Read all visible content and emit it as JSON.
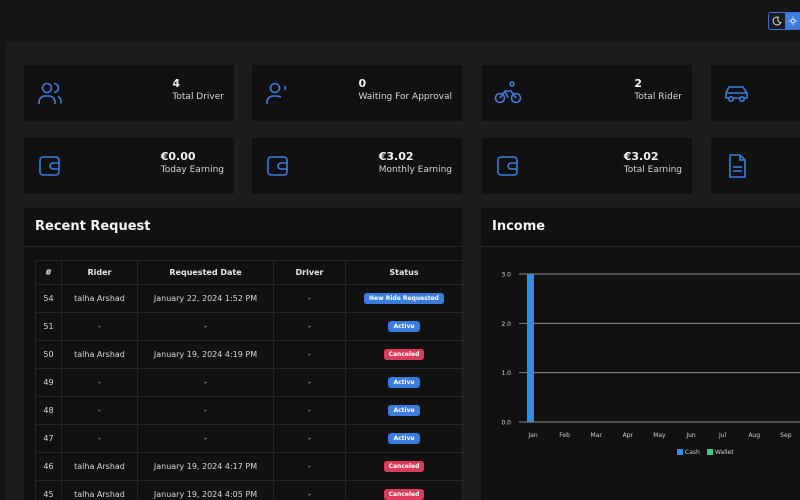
{
  "theme": {
    "dark_icon": "moon-icon",
    "light_icon": "sun-icon"
  },
  "stats": [
    {
      "icon": "users-icon",
      "value": "4",
      "label": "Total Driver"
    },
    {
      "icon": "user-clock-icon",
      "value": "0",
      "label": "Waiting For Approval"
    },
    {
      "icon": "bike-icon",
      "value": "2",
      "label": "Total Rider"
    },
    {
      "icon": "car-icon",
      "value": "",
      "label": ""
    },
    {
      "icon": "wallet-icon",
      "value": "€0.00",
      "label": "Today Earning"
    },
    {
      "icon": "wallet-icon",
      "value": "€3.02",
      "label": "Monthly Earning"
    },
    {
      "icon": "wallet-icon",
      "value": "€3.02",
      "label": "Total Earning"
    },
    {
      "icon": "document-icon",
      "value": "",
      "label": ""
    }
  ],
  "recent": {
    "title": "Recent Request",
    "columns": [
      "#",
      "Rider",
      "Requested Date",
      "Driver",
      "Status"
    ],
    "rows": [
      {
        "id": "54",
        "rider": "talha Arshad",
        "date": "January 22, 2024 1:52 PM",
        "driver": "-",
        "status": "New Ride Requested",
        "color": "#3b7ddd"
      },
      {
        "id": "51",
        "rider": "-",
        "date": "-",
        "driver": "-",
        "status": "Active",
        "color": "#3b7ddd"
      },
      {
        "id": "50",
        "rider": "talha Arshad",
        "date": "January 19, 2024 4:19 PM",
        "driver": "-",
        "status": "Canceled",
        "color": "#dc3b5b"
      },
      {
        "id": "49",
        "rider": "-",
        "date": "-",
        "driver": "-",
        "status": "Active",
        "color": "#3b7ddd"
      },
      {
        "id": "48",
        "rider": "-",
        "date": "-",
        "driver": "-",
        "status": "Active",
        "color": "#3b7ddd"
      },
      {
        "id": "47",
        "rider": "-",
        "date": "-",
        "driver": "-",
        "status": "Active",
        "color": "#3b7ddd"
      },
      {
        "id": "46",
        "rider": "talha Arshad",
        "date": "January 19, 2024 4:17 PM",
        "driver": "-",
        "status": "Canceled",
        "color": "#dc3b5b"
      },
      {
        "id": "45",
        "rider": "talha Arshad",
        "date": "January 19, 2024 4:05 PM",
        "driver": "-",
        "status": "Canceled",
        "color": "#dc3b5b"
      }
    ]
  },
  "income": {
    "title": "Income"
  },
  "chart_data": {
    "type": "bar",
    "title": "",
    "categories": [
      "Jan",
      "Feb",
      "Mar",
      "Apr",
      "May",
      "Jun",
      "Jul",
      "Aug",
      "Sep"
    ],
    "series": [
      {
        "name": "Cash",
        "color": "#2f8fe8",
        "values": [
          3.0,
          0,
          0,
          0,
          0,
          0,
          0,
          0,
          0
        ]
      },
      {
        "name": "Wallet",
        "color": "#2fcc8a",
        "values": [
          0,
          0,
          0,
          0,
          0,
          0,
          0,
          0,
          0
        ]
      }
    ],
    "yticks": [
      "0.0",
      "1.0",
      "2.0",
      "3.0"
    ],
    "ylim": [
      0,
      3
    ],
    "grid": true,
    "legend": "bottom"
  }
}
